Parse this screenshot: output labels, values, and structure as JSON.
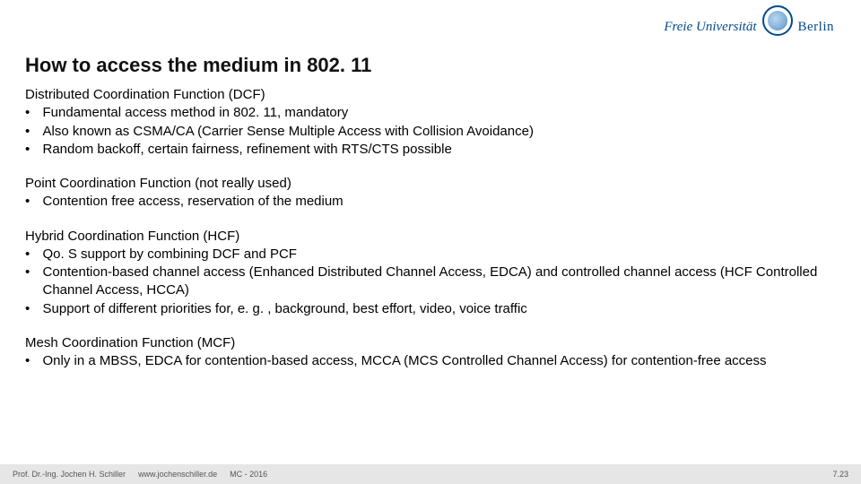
{
  "logo": {
    "fu_text": "Freie Universität",
    "berlin_text": "Berlin"
  },
  "title": "How to access the medium in 802. 11",
  "sections": [
    {
      "heading": "Distributed Coordination Function (DCF)",
      "bullets": [
        "Fundamental access method in 802. 11, mandatory",
        "Also known as CSMA/CA (Carrier Sense Multiple Access with Collision Avoidance)",
        "Random backoff, certain fairness, refinement with RTS/CTS possible"
      ]
    },
    {
      "heading": "Point Coordination Function (not really used)",
      "bullets": [
        "Contention free access, reservation of the medium"
      ]
    },
    {
      "heading": "Hybrid Coordination Function (HCF)",
      "bullets": [
        "Qo. S support by combining DCF and PCF",
        "Contention-based channel access (Enhanced Distributed Channel Access, EDCA) and controlled channel access (HCF Controlled Channel Access, HCCA)",
        "Support of different priorities for, e. g. , background, best effort, video, voice traffic"
      ]
    },
    {
      "heading": "Mesh Coordination Function (MCF)",
      "bullets": [
        "Only in a MBSS, EDCA for contention-based access, MCCA (MCS Controlled Channel Access) for contention-free access"
      ]
    }
  ],
  "footer": {
    "author": "Prof. Dr.-Ing. Jochen H. Schiller",
    "url": "www.jochenschiller.de",
    "course": "MC - 2016",
    "page": "7.23"
  }
}
